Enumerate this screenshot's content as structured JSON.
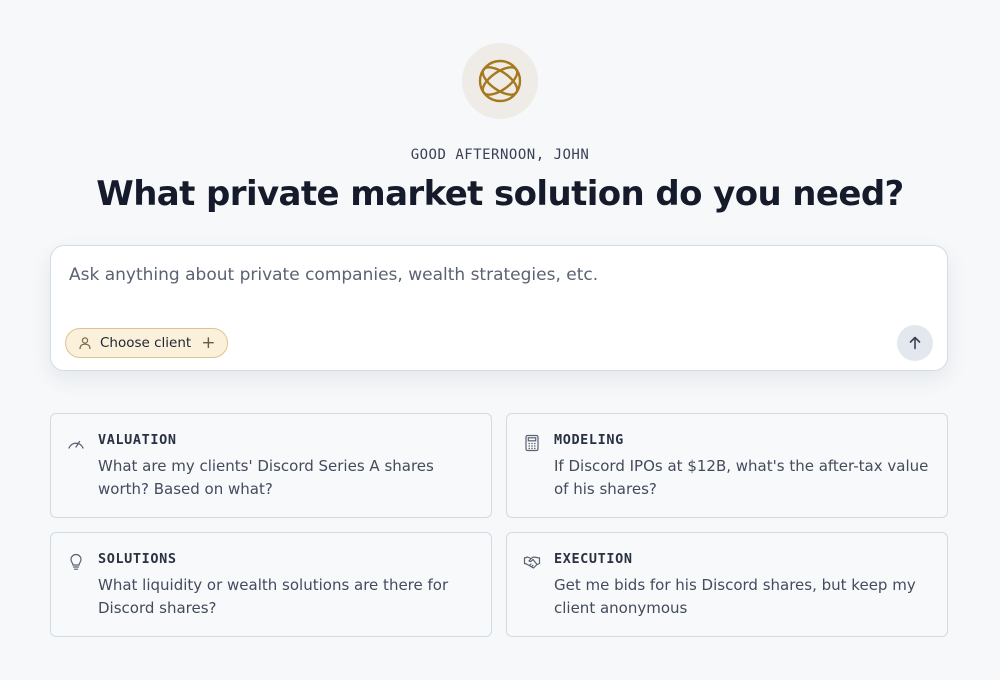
{
  "greeting": "GOOD AFTERNOON, JOHN",
  "headline": "What private market solution do you need?",
  "prompt": {
    "placeholder": "Ask anything about private companies, wealth strategies, etc.",
    "value": ""
  },
  "client_chip": {
    "label": "Choose client",
    "icon": "person-icon",
    "add_icon": "plus-icon"
  },
  "send_button": {
    "icon": "arrow-up-icon"
  },
  "cards": [
    {
      "tag": "VALUATION",
      "icon": "gauge-icon",
      "text": "What are my clients' Discord Series A shares worth? Based on what?"
    },
    {
      "tag": "MODELING",
      "icon": "calculator-icon",
      "text": "If Discord IPOs at $12B, what's the after-tax value of his shares?"
    },
    {
      "tag": "SOLUTIONS",
      "icon": "lightbulb-icon",
      "text": "What liquidity or wealth solutions are there for Discord shares?"
    },
    {
      "tag": "EXECUTION",
      "icon": "handshake-icon",
      "text": "Get me bids for his Discord shares, but keep my client anonymous"
    }
  ],
  "colors": {
    "background": "#f6f8fa",
    "accent_gold": "#a57a1e",
    "chip_fill": "#fbf0d9",
    "card_border": "#cfdbe5"
  }
}
